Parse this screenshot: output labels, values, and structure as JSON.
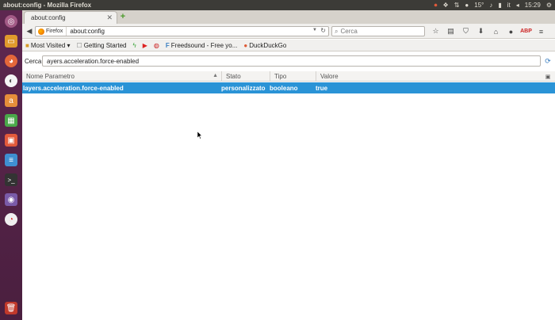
{
  "window": {
    "title": "about:config - Mozilla Firefox"
  },
  "tray": {
    "network": "⇅",
    "volume": "♪",
    "temperature": "15°",
    "keyboard": "it",
    "clock": "15:29"
  },
  "tabs": [
    {
      "label": "about:config"
    }
  ],
  "urlbar": {
    "identity": "Firefox",
    "url": "about:config"
  },
  "searchbar": {
    "placeholder": "Cerca"
  },
  "bookmarks": [
    {
      "label": "Most Visited ▾",
      "icon": "folder-icon"
    },
    {
      "label": "Getting Started",
      "icon": "page-icon"
    },
    {
      "label": "",
      "icon": "green-bolt-icon"
    },
    {
      "label": "",
      "icon": "youtube-icon"
    },
    {
      "label": "",
      "icon": "red-circle-icon"
    },
    {
      "label": "Freedsound - Free yo...",
      "icon": "freedsound-icon"
    },
    {
      "label": "DuckDuckGo",
      "icon": "duckduckgo-icon"
    }
  ],
  "config": {
    "search_label": "Cerca:",
    "search_value": "ayers.acceleration.force-enabled",
    "columns": {
      "name": "Nome Parametro",
      "stato": "Stato",
      "tipo": "Tipo",
      "valore": "Valore"
    },
    "rows": [
      {
        "name": "layers.acceleration.force-enabled",
        "stato": "personalizzato",
        "tipo": "booleano",
        "valore": "true"
      }
    ]
  },
  "colors": {
    "selection": "#2a93d6",
    "launcher": "#5e2750",
    "top_panel": "#3c3b37"
  }
}
